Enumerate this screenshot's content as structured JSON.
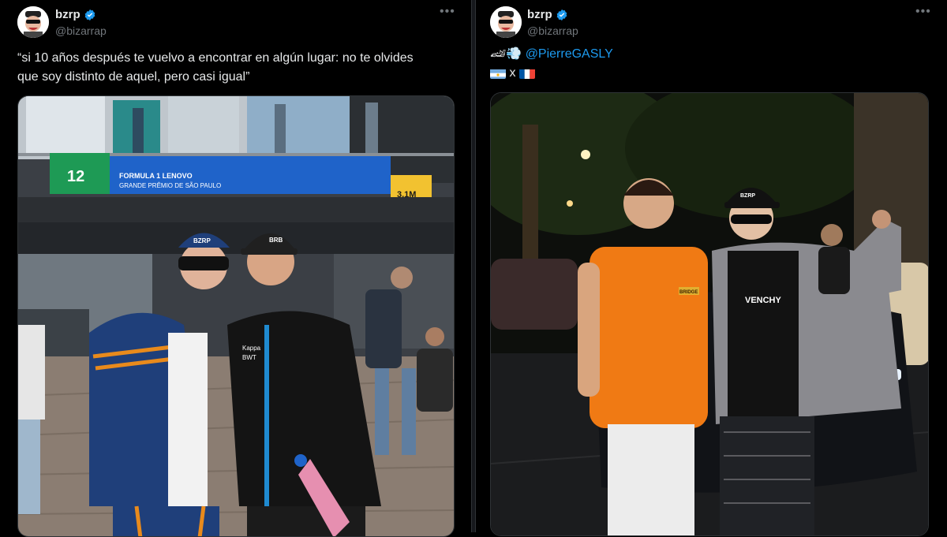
{
  "tweets": [
    {
      "author": {
        "name": "bzrp",
        "handle": "@bizarrap",
        "verified": true
      },
      "text": "“si 10 años después te vuelvo a encontrar en algún lugar: no te olvides que soy distinto de aquel, pero casi igual”",
      "text_line_1": "“si 10 años después te vuelvo a encontrar en algún lugar: no te olvides",
      "text_line_2": "que soy distinto de aquel, pero casi igual”",
      "more_icon": "•••",
      "media": {
        "banner_number": "12",
        "banner_brand": "FORMULA 1 LENOVO",
        "banner_event": "GRANDE PRÊMIO DE SÃO PAULO",
        "banner_height": "3,1M",
        "cap_left_text": "BZRP",
        "cap_right_text": "BRB",
        "jacket_brand": "Kappa",
        "jacket_logo": "BWT"
      }
    },
    {
      "author": {
        "name": "bzrp",
        "handle": "@bizarrap",
        "verified": true
      },
      "emojis": "🏎💨",
      "mention": "@PierreGASLY",
      "flags_separator": "x",
      "more_icon": "•••",
      "media": {
        "cap_text": "BZRP",
        "shirt_text": "VENCHY",
        "orange_shirt_label": "BRIDGE"
      }
    }
  ],
  "colors": {
    "background": "#000000",
    "text_primary": "#e7e9ea",
    "text_secondary": "#71767b",
    "link": "#1d9bf0",
    "verified": "#1d9bf0",
    "border": "#2f3336",
    "banner_blue": "#1f63c9",
    "banner_green": "#1e9a55",
    "banner_yellow": "#f2c230"
  }
}
